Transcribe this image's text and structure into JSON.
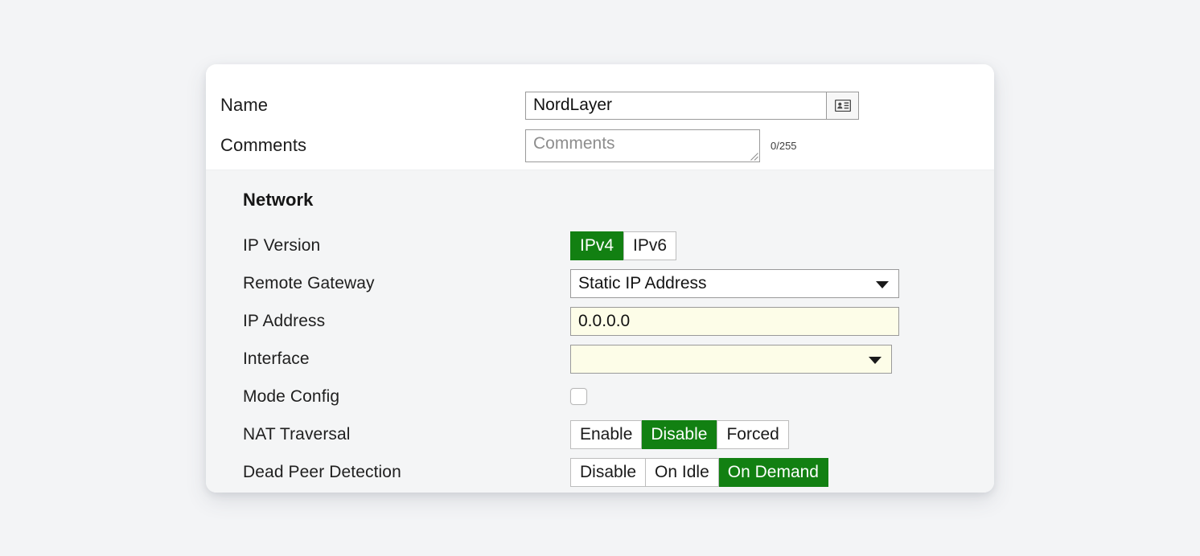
{
  "card": {
    "header": {
      "name_label": "Name",
      "name_value": "NordLayer",
      "name_icon": "contact-card-icon",
      "comments_label": "Comments",
      "comments_value": "",
      "comments_placeholder": "Comments",
      "comments_counter": "0/255"
    },
    "network": {
      "section_title": "Network",
      "ip_version": {
        "label": "IP Version",
        "options": [
          "IPv4",
          "IPv6"
        ],
        "selected": "IPv4"
      },
      "remote_gateway": {
        "label": "Remote Gateway",
        "value": "Static IP Address"
      },
      "ip_address": {
        "label": "IP Address",
        "value": "0.0.0.0"
      },
      "interface": {
        "label": "Interface",
        "value": ""
      },
      "mode_config": {
        "label": "Mode Config",
        "checked": false
      },
      "nat_traversal": {
        "label": "NAT Traversal",
        "options": [
          "Enable",
          "Disable",
          "Forced"
        ],
        "selected": "Disable"
      },
      "dead_peer_detection": {
        "label": "Dead Peer Detection",
        "options": [
          "Disable",
          "On Idle",
          "On Demand"
        ],
        "selected": "On Demand"
      }
    }
  },
  "colors": {
    "accent_green": "#128012",
    "page_bg": "#f3f4f6",
    "body_bg": "#f4f5f6",
    "field_cream": "#fdfde8"
  }
}
